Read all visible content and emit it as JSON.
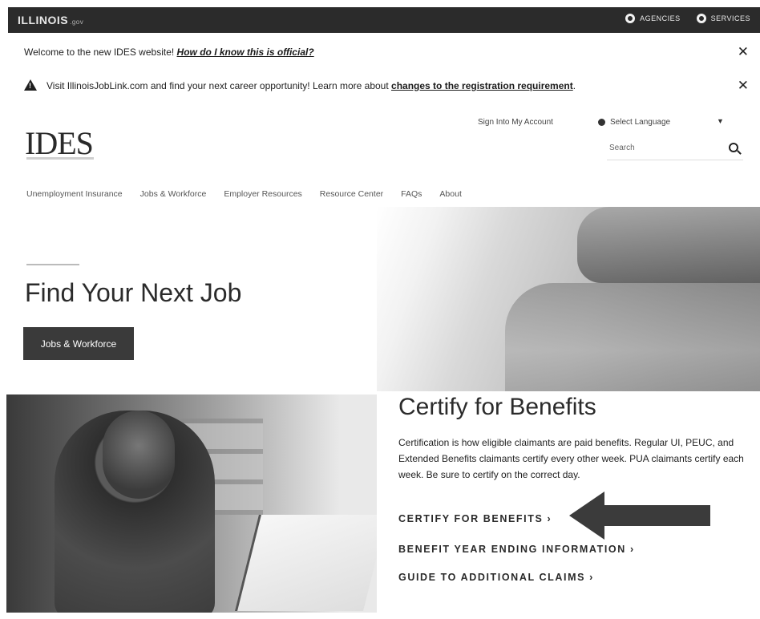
{
  "statebar": {
    "brand": "ILLINOIS",
    "brand_suffix": ".gov",
    "agencies": "AGENCIES",
    "services": "SERVICES"
  },
  "alerts": {
    "welcome_text": "Welcome to the new IDES website! ",
    "welcome_link": "How do I know this is official?",
    "joblink_text": "Visit IllinoisJobLink.com and find your next career opportunity! Learn more about ",
    "joblink_link": "changes to the registration requirement",
    "joblink_end": "."
  },
  "header": {
    "logo": "IDES",
    "signin": "Sign Into My Account",
    "language": "Select Language",
    "search_placeholder": "Search"
  },
  "nav": [
    "Unemployment Insurance",
    "Jobs & Workforce",
    "Employer Resources",
    "Resource Center",
    "FAQs",
    "About"
  ],
  "hero": {
    "title": "Find Your Next Job",
    "button": "Jobs & Workforce"
  },
  "certify": {
    "title": "Certify for Benefits",
    "body": "Certification is how eligible claimants are paid benefits. Regular UI, PEUC, and Extended Benefits claimants certify every other week. PUA claimants certify each week. Be sure to certify on the correct day.",
    "links": [
      "CERTIFY FOR BENEFITS  ›",
      "BENEFIT YEAR ENDING INFORMATION  ›",
      "GUIDE TO ADDITIONAL CLAIMS  ›"
    ]
  },
  "icons": {
    "warning": "warning-icon",
    "close": "close-icon",
    "globe": "globe-icon",
    "search": "search-icon",
    "arrow": "pointer-arrow-icon"
  }
}
